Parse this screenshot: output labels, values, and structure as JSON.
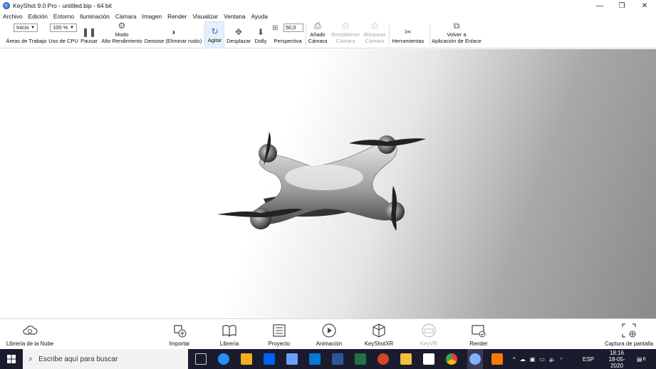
{
  "window": {
    "title": "KeyShot 9.0 Pro  - untitled.bip  - 64 bit",
    "minimize": "—",
    "restore": "❐",
    "close": "✕"
  },
  "menu": [
    "Archivo",
    "Edición",
    "Entorno",
    "Iluminación",
    "Cámara",
    "Imagen",
    "Render",
    "Visualizar",
    "Ventana",
    "Ayuda"
  ],
  "ribbon": {
    "workspace_value": "Inicio",
    "workspace_label": "Áreas de Trabajo",
    "cpu_value": "100 %",
    "cpu_label": "Uso de CPU",
    "pause_label": "Pausar",
    "hp_label": "Modo\nAlto Rendimiento",
    "denoise_label": "Denoise (Eliminar ruido)",
    "tumble_label": "Agitar",
    "pan_label": "Desplazar",
    "dolly_label": "Dolly",
    "perspective_value": "50,0",
    "perspective_label": "Perspectiva",
    "add_camera_label": "Añadir\nCámara",
    "reset_camera_label": "Restablecer\nCámara",
    "lock_camera_label": "Bloquear\nCámara",
    "tools_label": "Herramientas",
    "link_label": "Volver a\nAplicación de Enlace"
  },
  "bottom": {
    "cloud_library": "Librería de la Nube",
    "import": "Importar",
    "library": "Librería",
    "project": "Proyecto",
    "animation": "Animación",
    "keyshotxr": "KeyShotXR",
    "keyvr": "KeyVR",
    "render": "Render",
    "screenshot": "Captura de pantalla"
  },
  "taskbar": {
    "search_placeholder": "Escribe aquí para buscar",
    "language": "ESP",
    "time": "18:16",
    "date": "18-05-2020",
    "notifications": "6"
  }
}
